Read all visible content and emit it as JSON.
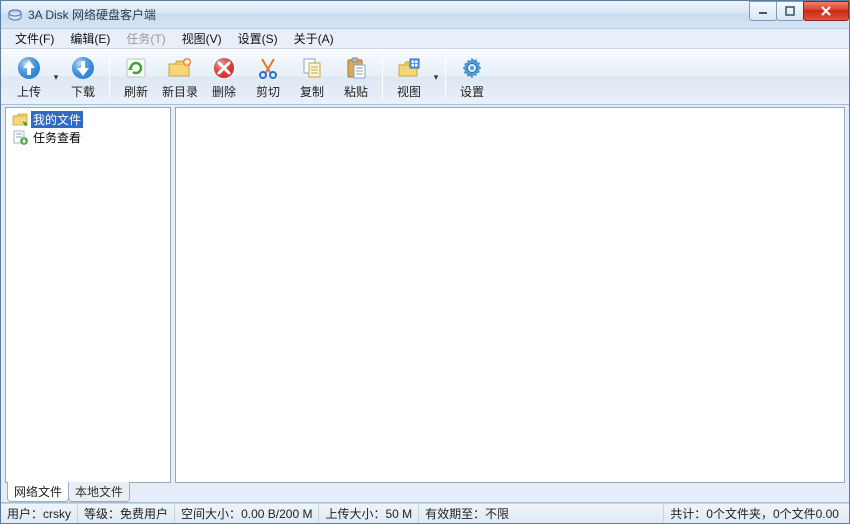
{
  "window": {
    "title": "3A Disk 网络硬盘客户端"
  },
  "menubar": {
    "file": "文件(F)",
    "edit": "编辑(E)",
    "task": "任务(T)",
    "view": "视图(V)",
    "settings": "设置(S)",
    "about": "关于(A)"
  },
  "toolbar": {
    "upload": "上传",
    "download": "下载",
    "refresh": "刷新",
    "newdir": "新目录",
    "delete": "删除",
    "cut": "剪切",
    "copy": "复制",
    "paste": "粘贴",
    "viewbtn": "视图",
    "settingsbtn": "设置"
  },
  "tree": {
    "myfiles": "我的文件",
    "taskview": "任务查看"
  },
  "tabs": {
    "network": "网络文件",
    "local": "本地文件"
  },
  "status": {
    "user_label": "用户：",
    "user_value": "crsky",
    "level_label": "等级：",
    "level_value": "免费用户",
    "space_label": "空间大小：",
    "space_value": "0.00 B/200 M",
    "uploadsize_label": "上传大小：",
    "uploadsize_value": "50 M",
    "expire_label": "有效期至：",
    "expire_value": "不限",
    "total_label": "共计：",
    "total_value": "0个文件夹，0个文件0.00"
  }
}
